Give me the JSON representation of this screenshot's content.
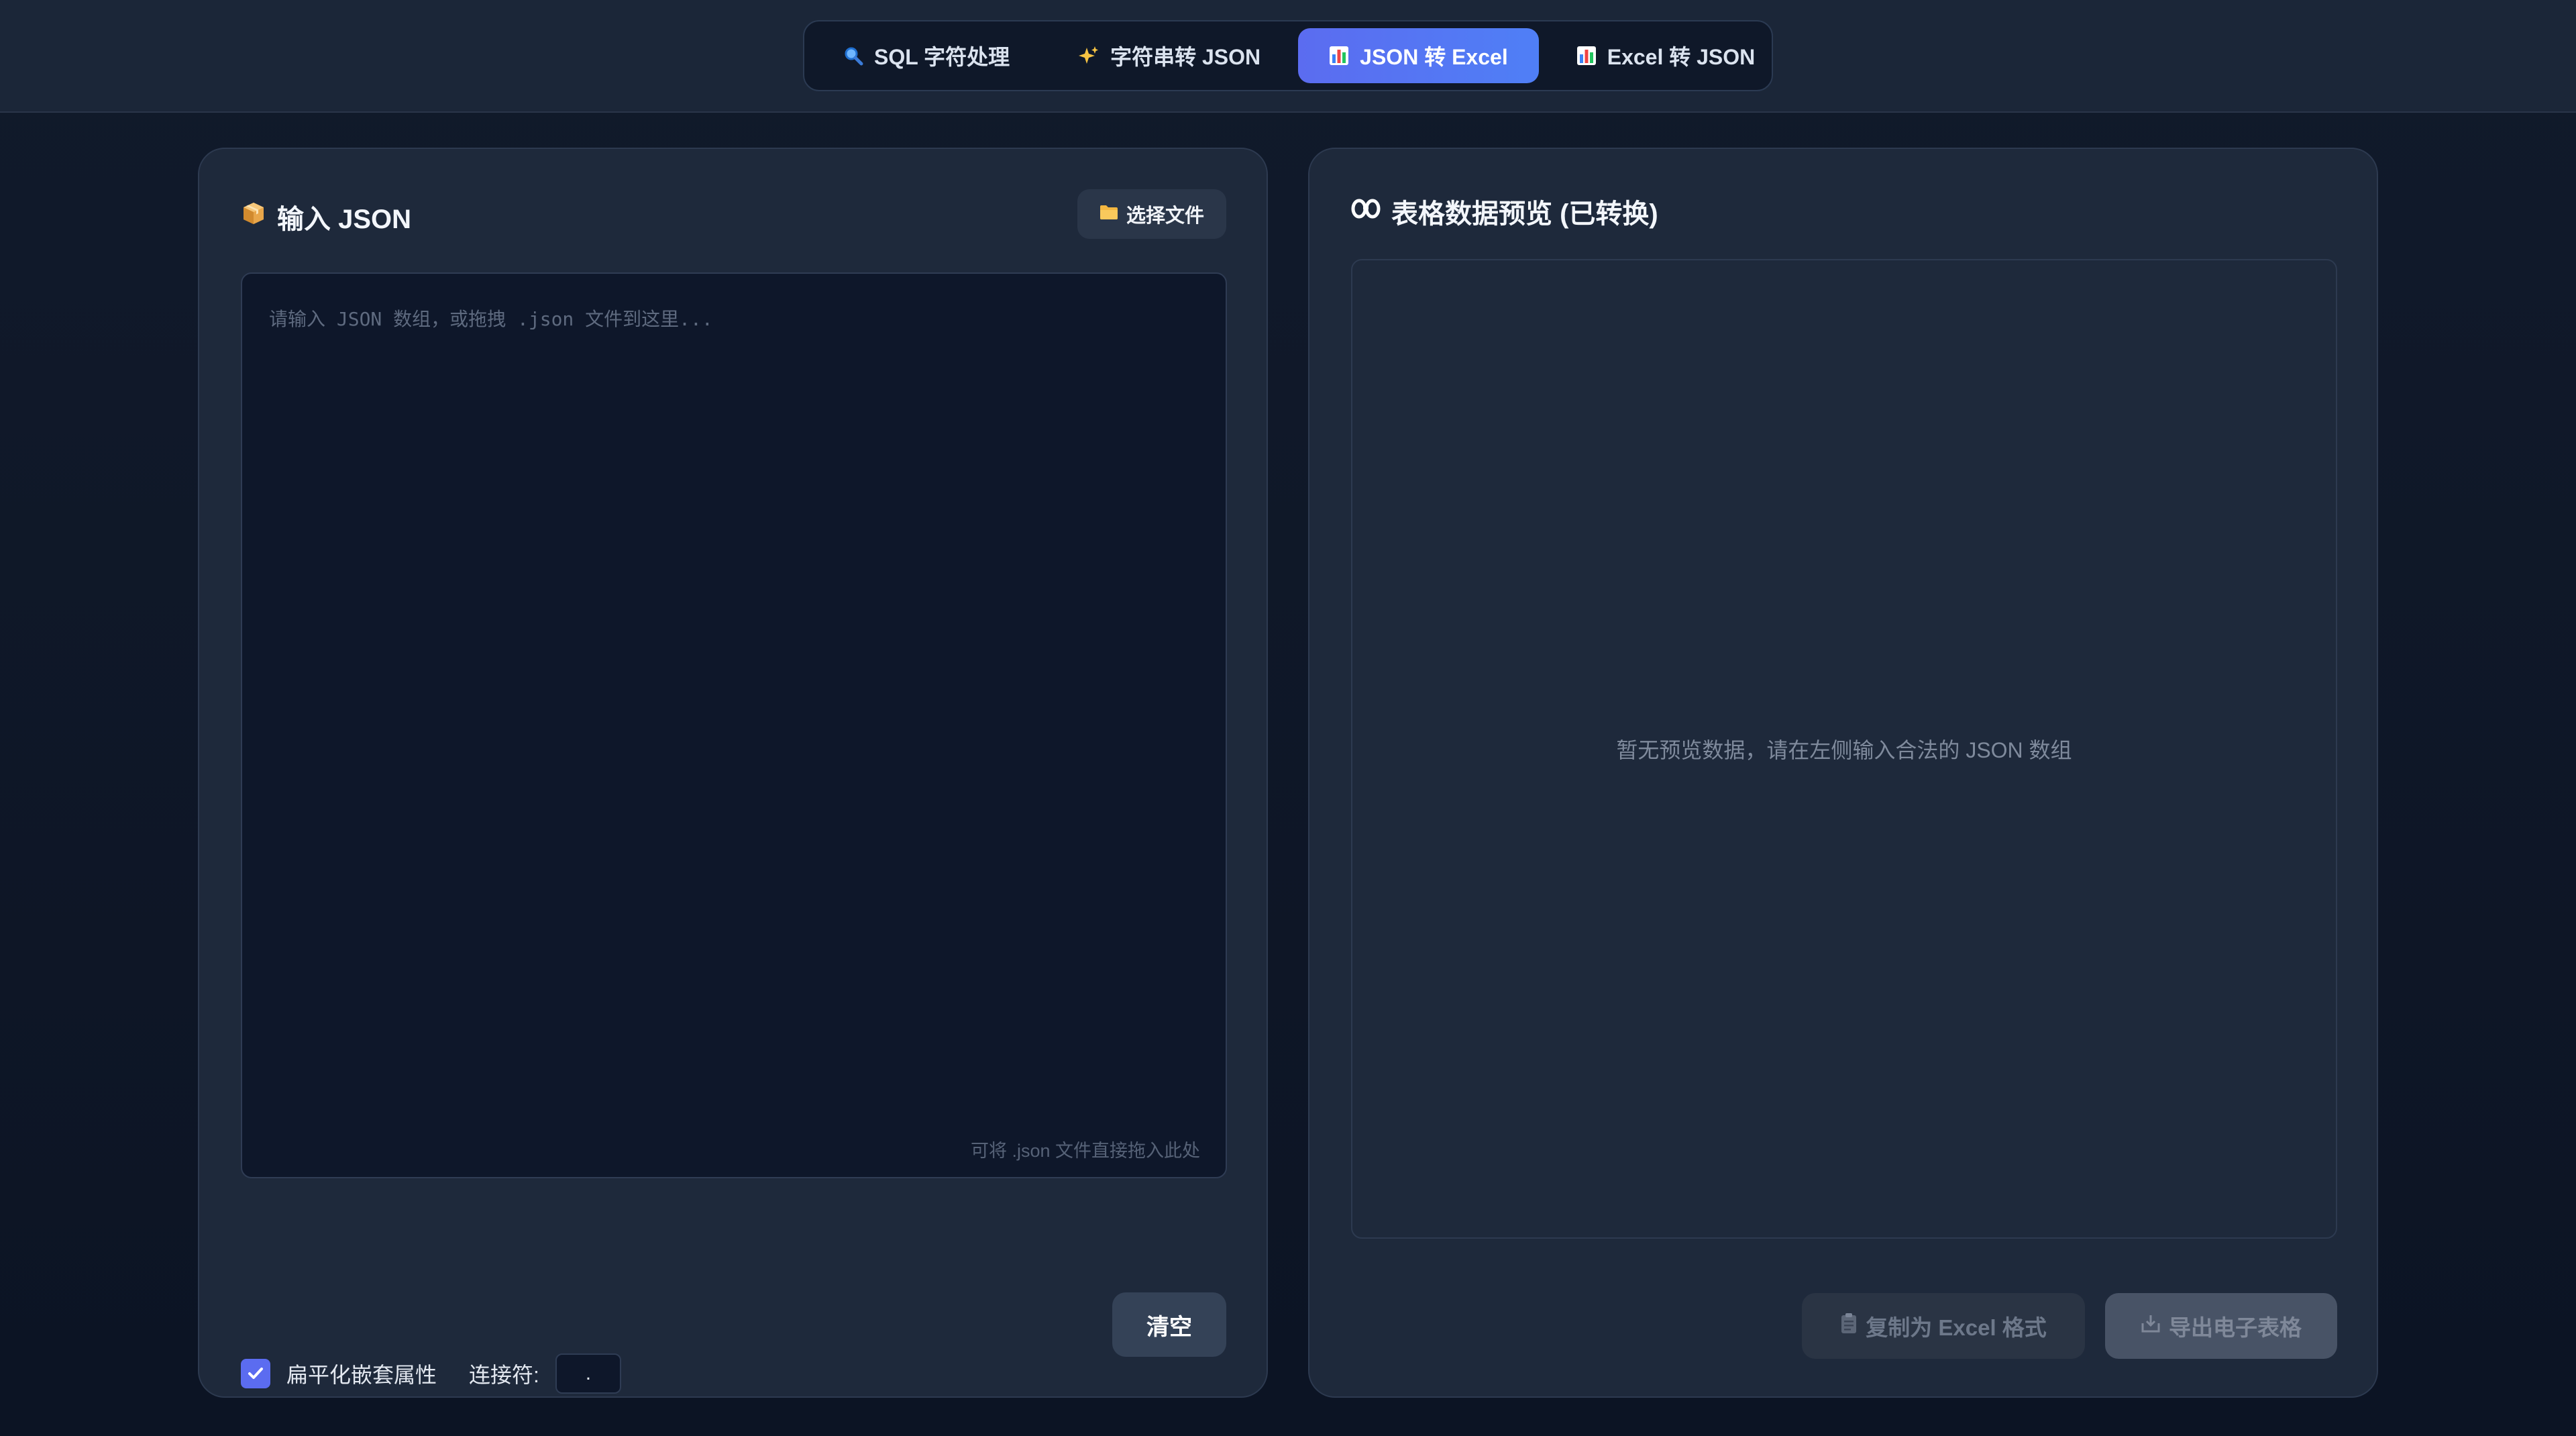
{
  "nav": {
    "tabs": [
      {
        "label": "SQL 字符处理",
        "icon": "magnifier-icon",
        "glyph": "🔍",
        "active": false
      },
      {
        "label": "字符串转 JSON",
        "icon": "sparkles-icon",
        "glyph": "✨",
        "active": false
      },
      {
        "label": "JSON 转 Excel",
        "icon": "bar-chart-icon",
        "glyph": "📊",
        "active": true
      },
      {
        "label": "Excel 转 JSON",
        "icon": "bar-chart-icon",
        "glyph": "📊",
        "active": false
      }
    ]
  },
  "input_panel": {
    "title": "输入 JSON",
    "title_icon_glyph": "📦",
    "file_button_label": "选择文件",
    "file_button_glyph": "📁",
    "editor_placeholder": "请输入 JSON 数组，或拖拽 .json 文件到这里...",
    "editor_value": "",
    "drop_hint": "可将 .json 文件直接拖入此处",
    "flatten_label": "扁平化嵌套属性",
    "flatten_checked": true,
    "separator_label": "连接符:",
    "separator_value": ".",
    "clear_button_label": "清空"
  },
  "preview_panel": {
    "title": "表格数据预览 (已转换)",
    "empty_message": "暂无预览数据，请在左侧输入合法的 JSON 数组",
    "copy_button_label": "复制为 Excel 格式",
    "copy_button_glyph": "📋",
    "export_button_label": "导出电子表格",
    "export_button_glyph": "📥"
  },
  "colors": {
    "accent": "#5b6cf0",
    "background": "#0f172a",
    "panel": "#1e293b"
  }
}
